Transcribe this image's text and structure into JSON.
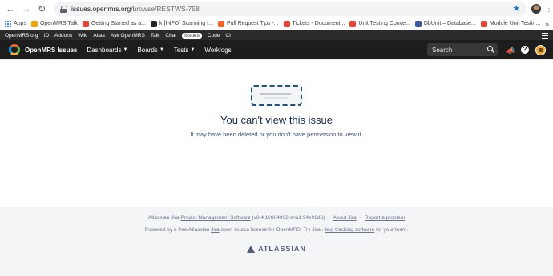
{
  "browser": {
    "url_host": "issues.openmrs.org",
    "url_path": "/browse/RESTWS-758",
    "bookmarks": [
      {
        "label": "Apps",
        "color": "#4285f4"
      },
      {
        "label": "OpenMRS Talk",
        "color": "#f4a300"
      },
      {
        "label": "Getting Started as a...",
        "color": "#e94235"
      },
      {
        "label": "k [INFO] Scanning f...",
        "color": "#222222"
      },
      {
        "label": "Pull Request Tips -...",
        "color": "#f26522"
      },
      {
        "label": "Tickets - Document...",
        "color": "#e94235"
      },
      {
        "label": "Unit Testing Conve...",
        "color": "#e94235"
      },
      {
        "label": "DbUnit – Database...",
        "color": "#3a5a9a"
      },
      {
        "label": "Module Unit Testin...",
        "color": "#e94235"
      }
    ],
    "more": "»"
  },
  "site_nav": [
    "OpenMRS.org",
    "ID",
    "Addons",
    "Wiki",
    "Atlas",
    "Ask OpenMRS",
    "Talk",
    "Chat",
    "Issues",
    "Code",
    "CI"
  ],
  "jira": {
    "title": "OpenMRS Issues",
    "menus": [
      "Dashboards",
      "Boards",
      "Tests",
      "Worklogs"
    ],
    "search_placeholder": "Search"
  },
  "error": {
    "title": "You can't view this issue",
    "subtitle": "It may have been deleted or you don't have permission to view it."
  },
  "footer": {
    "prefix": "Atlassian Jira ",
    "pms_link": "Project Management Software",
    "version": " (v8.4.1#804002-sha1:94e96d6)",
    "about": "About Jira",
    "report": "Report a problem",
    "powered_prefix": "Powered by a free Atlassian ",
    "jira_link": "Jira",
    "powered_mid": " open source license for OpenMRS. Try Jira - ",
    "bug_link": "bug tracking software",
    "powered_suffix": " for your team.",
    "brand": "ATLASSIAN"
  }
}
